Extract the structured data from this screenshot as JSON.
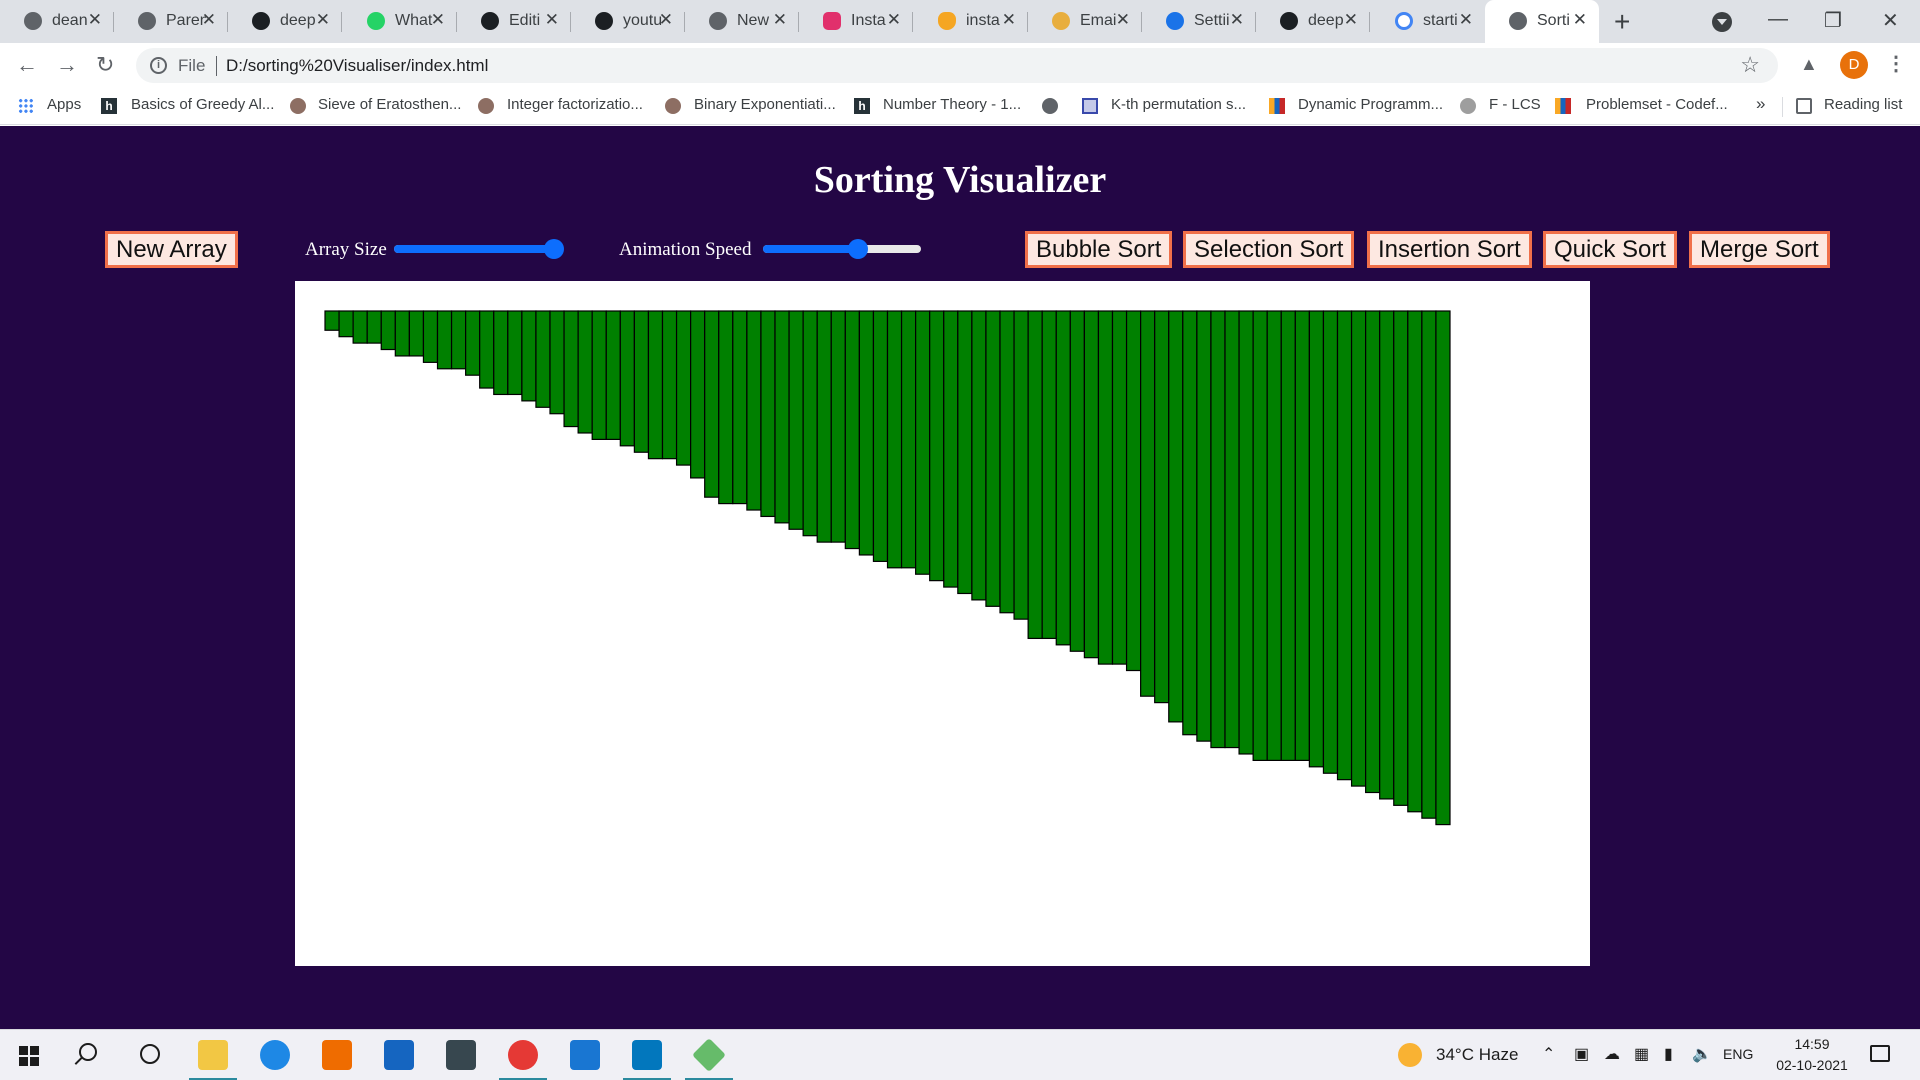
{
  "browser": {
    "tabs": [
      {
        "title": "dean",
        "icon": "globe-icon"
      },
      {
        "title": "Paren",
        "icon": "globe-icon"
      },
      {
        "title": "deep",
        "icon": "github-icon"
      },
      {
        "title": "What",
        "icon": "whatsapp-icon"
      },
      {
        "title": "Editi",
        "icon": "github-icon"
      },
      {
        "title": "youtu",
        "icon": "github-icon"
      },
      {
        "title": "New",
        "icon": "chrome-icon"
      },
      {
        "title": "Insta",
        "icon": "instagram-icon"
      },
      {
        "title": "insta",
        "icon": "firebase-icon"
      },
      {
        "title": "Emai",
        "icon": "mail-icon"
      },
      {
        "title": "Settii",
        "icon": "gear-icon"
      },
      {
        "title": "deep",
        "icon": "github-icon"
      },
      {
        "title": "starti",
        "icon": "google-icon"
      },
      {
        "title": "Sorti",
        "icon": "globe-icon",
        "active": true
      }
    ],
    "new_tab_label": "+",
    "scheme": "File",
    "url": "D:/sorting%20Visualiser/index.html",
    "profile_initial": "D",
    "bookmarks": [
      {
        "label": "Apps",
        "icon": "apps-grid-icon"
      },
      {
        "label": "Basics of Greedy Al...",
        "icon": "hackerearth-icon"
      },
      {
        "label": "Sieve of Eratosthen...",
        "icon": "owl-icon"
      },
      {
        "label": "Integer factorizatio...",
        "icon": "owl-icon"
      },
      {
        "label": "Binary Exponentiati...",
        "icon": "owl-icon"
      },
      {
        "label": "Number Theory - 1...",
        "icon": "hackerearth-icon"
      },
      {
        "label": "",
        "icon": "globe-icon"
      },
      {
        "label": "K-th permutation s...",
        "icon": "grid-icon"
      },
      {
        "label": "Dynamic Programm...",
        "icon": "codeforces-icon"
      },
      {
        "label": "F - LCS",
        "icon": "atcoder-icon"
      },
      {
        "label": "Problemset - Codef...",
        "icon": "codeforces-icon"
      }
    ],
    "bookmarks_overflow": "»",
    "reading_list": "Reading list"
  },
  "page": {
    "title": "Sorting Visualizer",
    "new_array_label": "New Array",
    "array_size_label": "Array Size",
    "array_size_value": 1.0,
    "animation_speed_label": "Animation Speed",
    "animation_speed_value": 0.6,
    "sort_buttons": [
      "Bubble Sort",
      "Selection Sort",
      "Insertion Sort",
      "Quick Sort",
      "Merge Sort"
    ],
    "colors": {
      "background": "#230645",
      "bar_fill": "#008000",
      "bar_stroke": "#000000",
      "button_border": "#f0704a",
      "slider": "#0d6efd"
    }
  },
  "chart_data": {
    "type": "bar",
    "title": "",
    "xlabel": "",
    "ylabel": "",
    "ylim": [
      0,
      100
    ],
    "values": [
      3,
      4,
      5,
      5,
      6,
      7,
      7,
      8,
      9,
      9,
      10,
      12,
      13,
      13,
      14,
      15,
      16,
      18,
      19,
      20,
      20,
      21,
      22,
      23,
      23,
      24,
      26,
      29,
      30,
      30,
      31,
      32,
      33,
      34,
      35,
      36,
      36,
      37,
      38,
      39,
      40,
      40,
      41,
      42,
      43,
      44,
      45,
      46,
      47,
      48,
      51,
      51,
      52,
      53,
      54,
      55,
      55,
      56,
      60,
      61,
      64,
      66,
      67,
      68,
      68,
      69,
      70,
      70,
      70,
      70,
      71,
      72,
      73,
      74,
      75,
      76,
      77,
      78,
      79,
      80
    ]
  },
  "taskbar": {
    "weather": "34°C  Haze",
    "language": "ENG",
    "time": "14:59",
    "date": "02-10-2021"
  }
}
